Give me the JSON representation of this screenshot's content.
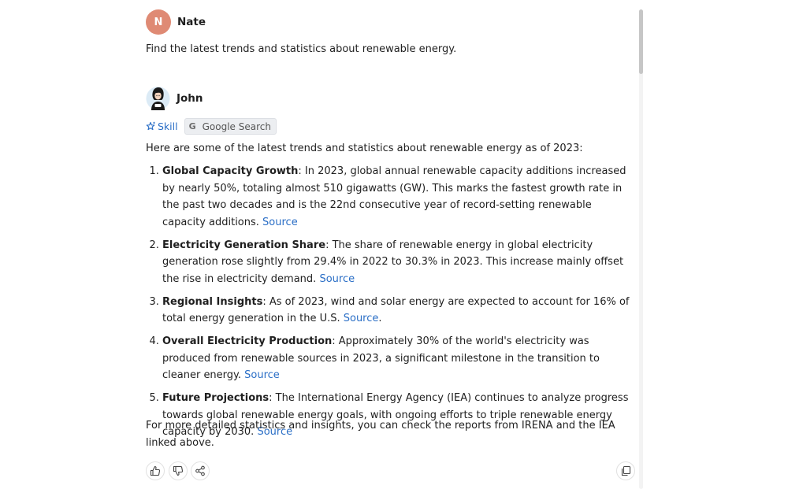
{
  "user": {
    "initial": "N",
    "name": "Nate",
    "message": "Find the latest trends and statistics about renewable energy."
  },
  "assistant": {
    "name": "John",
    "skill_label": "Skill",
    "tool_badge": {
      "icon_letter": "G",
      "label": "Google Search"
    },
    "intro": "Here are some of the latest trends and statistics about renewable energy as of 2023:",
    "items": [
      {
        "title": "Global Capacity Growth",
        "text": ": In 2023, global annual renewable capacity additions increased by nearly 50%, totaling almost 510 gigawatts (GW). This marks the fastest growth rate in the past two decades and is the 22nd consecutive year of record-setting renewable capacity additions. ",
        "link": "Source",
        "after": ""
      },
      {
        "title": "Electricity Generation Share",
        "text": ": The share of renewable energy in global electricity generation rose slightly from 29.4% in 2022 to 30.3% in 2023. This increase mainly offset the rise in electricity demand. ",
        "link": "Source",
        "after": ""
      },
      {
        "title": "Regional Insights",
        "text": ": As of 2023, wind and solar energy are expected to account for 16% of total energy generation in the U.S. ",
        "link": "Source",
        "after": "."
      },
      {
        "title": "Overall Electricity Production",
        "text": ": Approximately 30% of the world's electricity was produced from renewable sources in 2023, a significant milestone in the transition to cleaner energy. ",
        "link": "Source",
        "after": ""
      },
      {
        "title": "Future Projections",
        "text": ": The International Energy Agency (IEA) continues to analyze progress towards global renewable energy goals, with ongoing efforts to triple renewable energy capacity by 2030. ",
        "link": "Source",
        "after": ""
      }
    ],
    "outro": "For more detailed statistics and insights, you can check the reports from IRENA and the IEA linked above."
  },
  "actions": {
    "icons": [
      "thumbs-up-icon",
      "thumbs-down-icon",
      "share-icon",
      "copy-icon"
    ]
  },
  "colors": {
    "user_avatar": "#df8a74",
    "link": "#2a6ec6",
    "badge_bg": "#eceef1"
  }
}
